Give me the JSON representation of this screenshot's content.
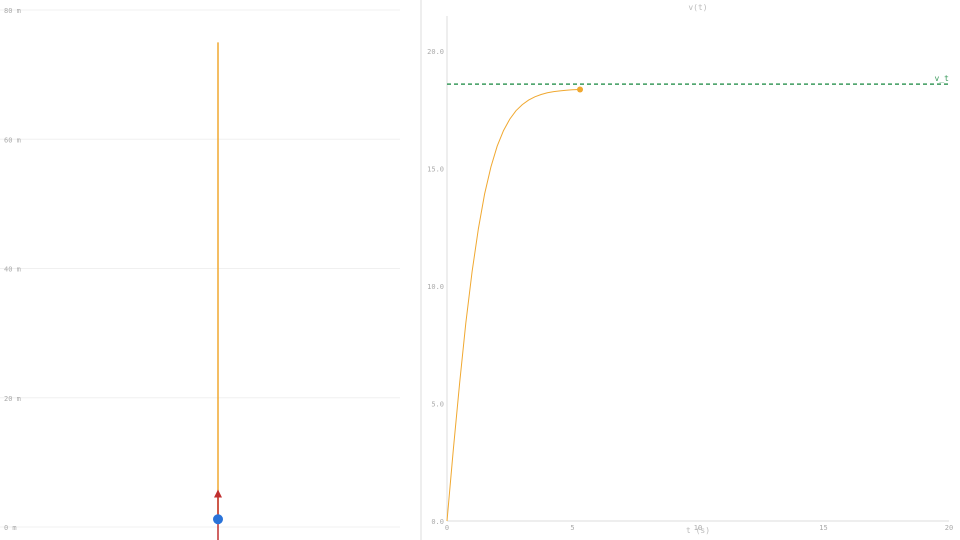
{
  "left_panel": {
    "height_labels": [
      "80 m",
      "60 m",
      "40 m",
      "20 m",
      "0 m"
    ],
    "height_values": [
      80,
      60,
      40,
      20,
      0
    ],
    "height_range": [
      0,
      80
    ],
    "trail_top_m": 75.0,
    "object_height_m": 1.2,
    "arrow_tip_m": 5.8,
    "colors": {
      "trail": "#f0a830",
      "object": "#2a73d9",
      "force_arrow": "#c03030",
      "grid": "#f0f0f0",
      "label": "#aaaaaa"
    }
  },
  "chart_data": {
    "type": "line",
    "title": "v(t)",
    "xlabel": "t (s)",
    "ylabel": "",
    "xlim": [
      0,
      20
    ],
    "ylim": [
      0,
      21.5
    ],
    "x_ticks": [
      "0",
      "5",
      "10",
      "15",
      "20"
    ],
    "x_tick_values": [
      0,
      5,
      10,
      15,
      20
    ],
    "y_ticks": [
      "0.0",
      "5.0",
      "10.0",
      "15.0",
      "20.0"
    ],
    "y_tick_values": [
      0,
      5,
      10,
      15,
      20
    ],
    "grid": false,
    "series": [
      {
        "color": "#f0a830",
        "x": [
          0,
          0.25,
          0.5,
          0.75,
          1.0,
          1.25,
          1.5,
          1.75,
          2.0,
          2.25,
          2.5,
          2.75,
          3.0,
          3.25,
          3.5,
          3.75,
          4.0,
          4.25,
          4.5,
          4.75,
          5.0,
          5.3
        ],
        "y": [
          0,
          3.03,
          5.86,
          8.42,
          10.62,
          12.45,
          13.92,
          15.07,
          15.96,
          16.62,
          17.11,
          17.47,
          17.73,
          17.92,
          18.06,
          18.16,
          18.23,
          18.28,
          18.31,
          18.34,
          18.36,
          18.37
        ]
      }
    ],
    "current_point": {
      "x": 5.3,
      "y": 18.37
    },
    "reference_line": {
      "label": "v_t",
      "y": 18.6,
      "color": "#3a9a5c",
      "style": "dashed"
    }
  }
}
